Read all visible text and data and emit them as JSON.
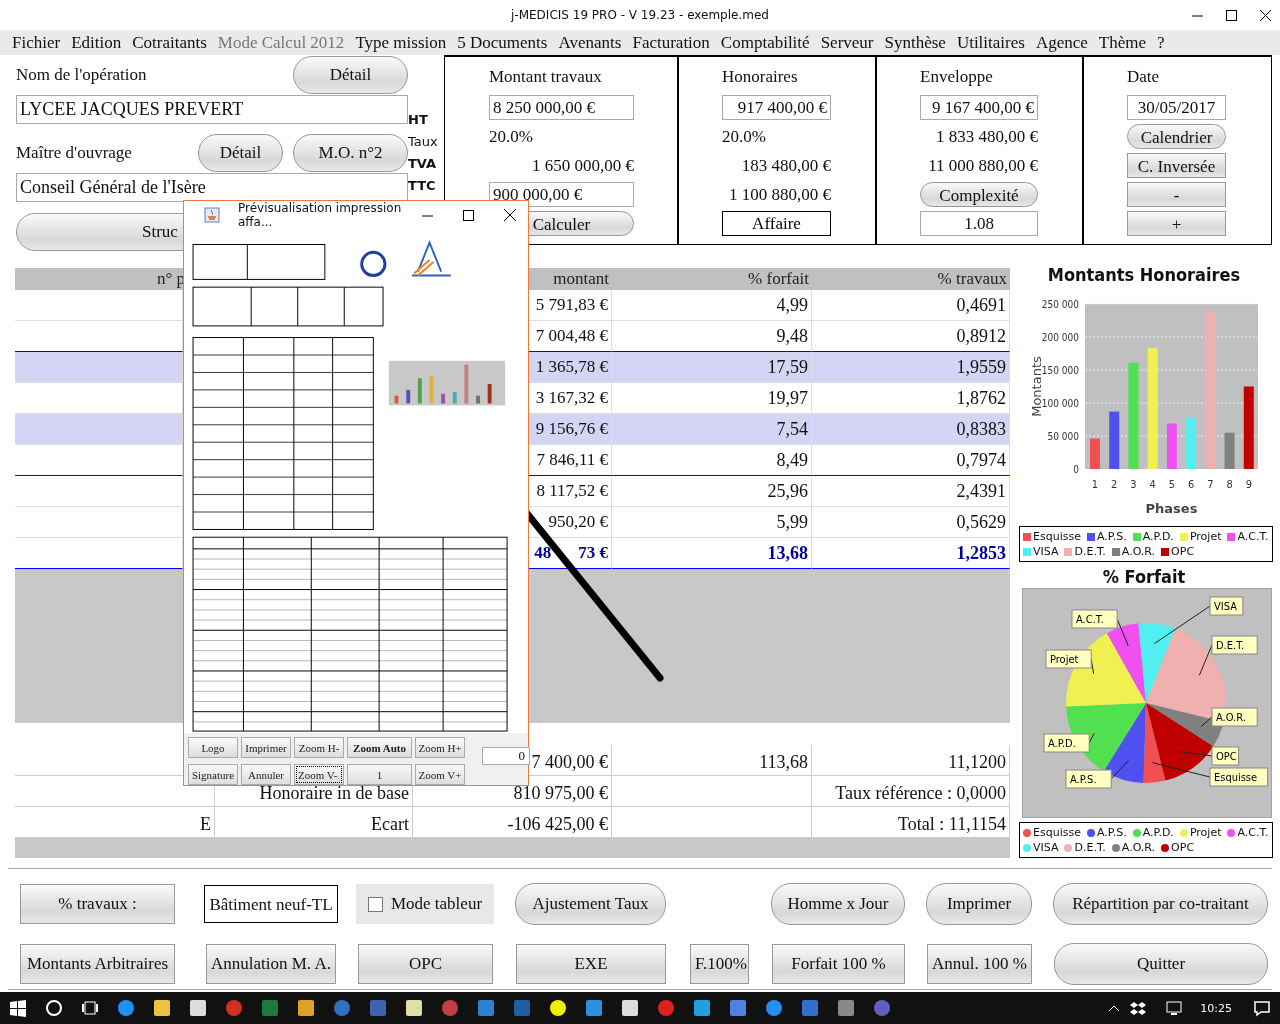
{
  "window": {
    "title": "j-MEDICIS 19 PRO - V 19.23 - exemple.med"
  },
  "menu": [
    {
      "label": "Fichier",
      "disabled": false
    },
    {
      "label": "Edition",
      "disabled": false
    },
    {
      "label": "Cotraitants",
      "disabled": false
    },
    {
      "label": "Mode Calcul 2012",
      "disabled": true
    },
    {
      "label": "Type mission",
      "disabled": false
    },
    {
      "label": "5 Documents",
      "disabled": false
    },
    {
      "label": "Avenants",
      "disabled": false
    },
    {
      "label": "Facturation",
      "disabled": false
    },
    {
      "label": "Comptabilité",
      "disabled": false
    },
    {
      "label": "Serveur",
      "disabled": false
    },
    {
      "label": "Synthèse",
      "disabled": false
    },
    {
      "label": "Utilitaires",
      "disabled": false
    },
    {
      "label": "Agence",
      "disabled": false
    },
    {
      "label": "Thème",
      "disabled": false
    },
    {
      "label": "?",
      "disabled": false
    }
  ],
  "operation": {
    "label": "Nom de l'opération",
    "button": "Détail",
    "value": "LYCEE JACQUES PREVERT"
  },
  "owner": {
    "label": "Maître d'ouvrage",
    "buttons": [
      "Détail",
      "M.O. n°2"
    ],
    "value": "Conseil Général de l'Isère"
  },
  "structure_button": "Struc",
  "row_labels": [
    {
      "text": "HT",
      "bold": true
    },
    {
      "text": "Taux",
      "bold": false
    },
    {
      "text": "TVA",
      "bold": true
    },
    {
      "text": "TTC",
      "bold": true
    }
  ],
  "boxes": [
    {
      "title": "Montant travaux",
      "items": [
        {
          "kind": "field",
          "text": "8 250 000,00 €"
        },
        {
          "kind": "percent",
          "text": "20.0%"
        },
        {
          "kind": "amount",
          "text": "1 650 000,00 €"
        },
        {
          "kind": "field",
          "text": "900 000,00 €"
        },
        {
          "kind": "round-button",
          "text": "Calculer"
        }
      ]
    },
    {
      "title": "Honoraires",
      "items": [
        {
          "kind": "field",
          "text": "917 400,00 €"
        },
        {
          "kind": "percent",
          "text": "20.0%"
        },
        {
          "kind": "amount",
          "text": "183 480,00 €"
        },
        {
          "kind": "amount",
          "text": "1 100 880,00 €"
        },
        {
          "kind": "outlined-button",
          "text": "Affaire"
        }
      ]
    },
    {
      "title": "Enveloppe",
      "items": [
        {
          "kind": "field",
          "text": "9 167 400,00 €"
        },
        {
          "kind": "amount",
          "text": "1 833 480,00 €"
        },
        {
          "kind": "amount",
          "text": "11 000 880,00 €"
        },
        {
          "kind": "round-button",
          "text": "Complexité"
        },
        {
          "kind": "field",
          "text": "1.08"
        }
      ]
    },
    {
      "title": "Date",
      "items": [
        {
          "kind": "field",
          "text": "30/05/2017"
        },
        {
          "kind": "round-button",
          "text": "Calendrier"
        },
        {
          "kind": "square-button",
          "text": "C. Inversée"
        },
        {
          "kind": "square-button",
          "text": "-"
        },
        {
          "kind": "square-button",
          "text": "+"
        }
      ]
    }
  ],
  "table": {
    "columns": [
      "n° p",
      "montant",
      "% forfait",
      "% travaux"
    ],
    "rows": [
      {
        "amount": [
          "5 791,83 €"
        ],
        "forfait": "4,99",
        "travaux": "0,4691",
        "selected": false,
        "rule_after": false,
        "emphasized": false
      },
      {
        "amount": [
          "7 004,48 €"
        ],
        "forfait": "9,48",
        "travaux": "0,8912",
        "selected": false,
        "rule_after": true,
        "emphasized": false
      },
      {
        "amount": [
          "1 365,78 €"
        ],
        "forfait": "17,59",
        "travaux": "1,9559",
        "selected": true,
        "rule_after": false,
        "emphasized": false
      },
      {
        "amount": [
          "3 167,32 €"
        ],
        "forfait": "19,97",
        "travaux": "1,8762",
        "selected": false,
        "rule_after": false,
        "emphasized": false
      },
      {
        "amount": [
          "9 156,76 €"
        ],
        "forfait": "7,54",
        "travaux": "0,8383",
        "selected": true,
        "rule_after": false,
        "emphasized": false
      },
      {
        "amount": [
          "7 846,11 €"
        ],
        "forfait": "8,49",
        "travaux": "0,7974",
        "selected": false,
        "rule_after": true,
        "emphasized": false
      },
      {
        "amount": [
          "8 117,52 €"
        ],
        "forfait": "25,96",
        "travaux": "2,4391",
        "selected": false,
        "rule_after": false,
        "emphasized": false
      },
      {
        "amount": [
          "950,20 €"
        ],
        "forfait": "5,99",
        "travaux": "0,5629",
        "selected": false,
        "rule_after": false,
        "emphasized": false
      },
      {
        "amount": [
          "48",
          "73 €"
        ],
        "forfait": "13,68",
        "travaux": "1,2853",
        "selected": false,
        "rule_after": true,
        "emphasized": true
      }
    ]
  },
  "summary": {
    "rows": [
      {
        "col_1": "",
        "col_2": "",
        "col_3": "7 400,00 €",
        "col_4": "113,68",
        "col_5": "11,1200"
      },
      {
        "col_1": "",
        "col_2": "Honoraire in de base",
        "col_3": "810 975,00 €",
        "col_4": "",
        "col_5": "Taux référence : 0,0000"
      },
      {
        "col_1": "E",
        "col_2": "Ecart",
        "col_3": "-106 425,00 €",
        "col_4": "",
        "col_5": "Total : 11,1154"
      }
    ]
  },
  "bar_chart": {
    "legend": [
      {
        "label": "Esquisse",
        "color": "#f05050"
      },
      {
        "label": "A.P.S.",
        "color": "#5050f0"
      },
      {
        "label": "A.P.D.",
        "color": "#50e050"
      },
      {
        "label": "Projet",
        "color": "#f0f050"
      },
      {
        "label": "A.C.T.",
        "color": "#f050f0"
      },
      {
        "label": "VISA",
        "color": "#50f0f0"
      },
      {
        "label": "D.E.T.",
        "color": "#f0b0b0"
      },
      {
        "label": "A.O.R.",
        "color": "#808080"
      },
      {
        "label": "OPC",
        "color": "#c00000"
      }
    ],
    "chart_data": {
      "type": "bar",
      "title": "Montants Honoraires",
      "xlabel": "Phases",
      "ylabel": "Montants",
      "categories": [
        "1",
        "2",
        "3",
        "4",
        "5",
        "6",
        "7",
        "8",
        "9"
      ],
      "series": [
        {
          "values": [
            46000,
            87000,
            161000,
            183000,
            69000,
            78000,
            238000,
            55000,
            125000
          ]
        }
      ],
      "ylim": [
        0,
        250000
      ],
      "grid": true,
      "yticks": [
        {
          "value": 0,
          "label": "0"
        },
        {
          "value": 50000,
          "label": "50 000"
        },
        {
          "value": 100000,
          "label": "100 000"
        },
        {
          "value": 150000,
          "label": "150 000"
        },
        {
          "value": 200000,
          "label": "200 000"
        },
        {
          "value": 250000,
          "label": "250 000"
        }
      ]
    }
  },
  "pie_chart": {
    "legend": [
      {
        "label": "Esquisse",
        "color": "#f05050"
      },
      {
        "label": "A.P.S.",
        "color": "#5050f0"
      },
      {
        "label": "A.P.D.",
        "color": "#50e050"
      },
      {
        "label": "Projet",
        "color": "#f0f050"
      },
      {
        "label": "A.C.T.",
        "color": "#f050f0"
      },
      {
        "label": "VISA",
        "color": "#50f0f0"
      },
      {
        "label": "D.E.T.",
        "color": "#f0b0b0"
      },
      {
        "label": "A.O.R.",
        "color": "#808080"
      },
      {
        "label": "OPC",
        "color": "#c00000"
      }
    ],
    "chart_data": {
      "type": "pie",
      "title": "% Forfait",
      "categories": [
        "Esquisse",
        "A.P.S.",
        "A.P.D.",
        "Projet",
        "A.C.T.",
        "VISA",
        "D.E.T.",
        "A.O.R.",
        "OPC"
      ],
      "series": [
        {
          "values": [
            4.39,
            8.34,
            15.47,
            17.57,
            6.63,
            7.47,
            22.83,
            5.27,
            12.03
          ]
        }
      ]
    }
  },
  "buttons": [
    [
      {
        "kind": "square",
        "text": "% travaux :"
      },
      {
        "kind": "field",
        "text": "Bâtiment neuf-TL"
      },
      {
        "kind": "checkbox",
        "text": "Mode tableur",
        "checked": false
      },
      {
        "kind": "round",
        "text": "Ajustement Taux"
      },
      {
        "kind": "round",
        "text": "Homme x Jour"
      },
      {
        "kind": "round",
        "text": "Imprimer"
      },
      {
        "kind": "round",
        "text": "Répartition par co-traitant"
      }
    ],
    [
      {
        "kind": "square",
        "text": "Montants Arbitraires"
      },
      {
        "kind": "square",
        "text": "Annulation M. A."
      },
      {
        "kind": "square",
        "text": "OPC"
      },
      {
        "kind": "square",
        "text": "EXE"
      },
      {
        "kind": "square",
        "text": "F.100%"
      },
      {
        "kind": "square",
        "text": "Forfait 100 %"
      },
      {
        "kind": "square",
        "text": "Annul. 100 %"
      },
      {
        "kind": "round",
        "text": "Quitter"
      }
    ]
  ],
  "preview": {
    "title": "Prévisualisation impression affa...",
    "buttons": [
      [
        {
          "text": "Logo",
          "default": false,
          "focused": false
        },
        {
          "text": "Imprimer",
          "default": false,
          "focused": false
        },
        {
          "text": "Zoom H-",
          "default": false,
          "focused": false
        },
        {
          "text": "Zoom Auto",
          "default": true,
          "focused": false
        },
        {
          "text": "Zoom H+",
          "default": false,
          "focused": false
        }
      ],
      [
        {
          "text": "Signature",
          "default": false,
          "focused": false
        },
        {
          "text": "Annuler",
          "default": false,
          "focused": false
        },
        {
          "text": "Zoom V-",
          "default": false,
          "focused": true
        },
        {
          "text": "1",
          "default": false,
          "focused": false
        },
        {
          "text": "Zoom V+",
          "default": false,
          "focused": false
        }
      ]
    ],
    "spinner": "0"
  },
  "taskbar": {
    "clock": "10:25"
  }
}
